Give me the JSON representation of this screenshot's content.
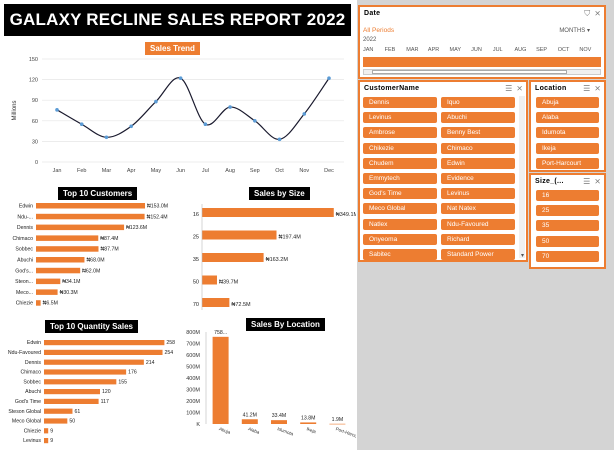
{
  "report": {
    "title": "GALAXY RECLINE SALES REPORT 2022"
  },
  "charts": {
    "sales_trend_title": "Sales Trend",
    "top_customers_title": "Top 10 Customers",
    "sales_by_size_title": "Sales by Size",
    "top_quantity_title": "Top 10 Quantity Sales",
    "sales_by_location_title": "Sales By Location"
  },
  "chart_data": [
    {
      "id": "sales_trend",
      "type": "line",
      "title": "Sales Trend",
      "ylabel": "Millions",
      "xlabel": "",
      "categories": [
        "Jan",
        "Feb",
        "Mar",
        "Apr",
        "May",
        "Jun",
        "Jul",
        "Aug",
        "Sep",
        "Oct",
        "Nov",
        "Dec"
      ],
      "values": [
        76,
        55,
        36,
        52,
        88,
        122,
        55,
        80,
        60,
        33,
        70,
        122
      ],
      "ylim": [
        0,
        150
      ],
      "yticks": [
        0,
        30,
        60,
        90,
        120,
        150
      ],
      "grid": true,
      "color": "#1f4e79",
      "marker_color": "#5b9bd5"
    },
    {
      "id": "top_customers",
      "type": "bar",
      "orientation": "horizontal",
      "title": "Top 10 Customers",
      "categories": [
        "Edwin",
        "Ndu-...",
        "Dennis",
        "Chimaco",
        "Sobbec",
        "Abuchi",
        "God's...",
        "Steon...",
        "Meco...",
        "Chiezie"
      ],
      "values": [
        153.0,
        152.4,
        123.6,
        87.4,
        87.7,
        68.0,
        62.0,
        34.1,
        30.3,
        6.5
      ],
      "labels": [
        "₦153.0M",
        "₦152.4M",
        "₦123.6M",
        "₦87.4M",
        "₦87.7M",
        "₦68.0M",
        "₦62.0M",
        "₦34.1M",
        "₦30.3M",
        "₦6.5M"
      ],
      "xlim": [
        0,
        160
      ],
      "color": "#ed7d31"
    },
    {
      "id": "sales_by_size",
      "type": "bar",
      "orientation": "horizontal",
      "title": "Sales by Size",
      "categories": [
        "16",
        "25",
        "35",
        "50",
        "70"
      ],
      "values": [
        349.1,
        197.4,
        163.2,
        39.7,
        72.5
      ],
      "labels": [
        "₦349.1M",
        "₦197.4M",
        "₦163.2M",
        "₦39.7M",
        "₦72.5M"
      ],
      "xlim": [
        0,
        355
      ],
      "color": "#ed7d31"
    },
    {
      "id": "top_quantity",
      "type": "bar",
      "orientation": "horizontal",
      "title": "Top 10 Quantity Sales",
      "categories": [
        "Edwin",
        "Ndu-Favoured",
        "Dennis",
        "Chimaco",
        "Sobbec",
        "Abuchi",
        "God's Time",
        "Steson Global",
        "Meco Global",
        "Chiezie",
        "Levinus"
      ],
      "values": [
        258,
        254,
        214,
        176,
        155,
        120,
        117,
        61,
        50,
        9,
        9
      ],
      "labels": [
        "258",
        "254",
        "214",
        "176",
        "155",
        "120",
        "117",
        "61",
        "50",
        "9",
        "9"
      ],
      "xlim": [
        0,
        270
      ],
      "color": "#ed7d31"
    },
    {
      "id": "sales_by_location",
      "type": "bar",
      "orientation": "vertical",
      "title": "Sales By Location",
      "categories": [
        "Abuja",
        "Alaba",
        "Idumota",
        "Ikeja",
        "Port-Harcourt"
      ],
      "values": [
        758,
        41.2,
        33.4,
        13.8,
        1.9
      ],
      "labels": [
        "758...",
        "41.2M",
        "33.4M",
        "13.8M",
        "1.9M"
      ],
      "ylim": [
        0,
        800
      ],
      "yticks": [
        "K",
        "100M",
        "200M",
        "300M",
        "400M",
        "500M",
        "600M",
        "700M",
        "800M"
      ],
      "color": "#ed7d31"
    }
  ],
  "slicers": {
    "date": {
      "header": "Date",
      "all_periods": "All Periods",
      "months_label": "MONTHS",
      "year": "2022",
      "months": [
        "JAN",
        "FEB",
        "MAR",
        "APR",
        "MAY",
        "JUN",
        "JUL",
        "AUG",
        "SEP",
        "OCT",
        "NOV"
      ]
    },
    "customer": {
      "header": "CustomerName",
      "items": [
        "Dennis",
        "Iquo",
        "Levinus",
        "Abuchi",
        "Ambrose",
        "Benny Best",
        "Chikezie",
        "Chimaco",
        "Chudem",
        "Edwin",
        "Emmytech",
        "Evidence",
        "God's Time",
        "Levinus",
        "Meco Global",
        "Nat Natex",
        "Natlex",
        "Ndu-Favoured",
        "Onyeoma",
        "Richard",
        "Sabitec",
        "Standard Power"
      ]
    },
    "location": {
      "header": "Location",
      "items": [
        "Abuja",
        "Alaba",
        "Idumota",
        "Ikeja",
        "Port-Harcourt"
      ]
    },
    "size": {
      "header": "Size_(...",
      "items": [
        "16",
        "25",
        "35",
        "50",
        "70"
      ]
    }
  },
  "colors": {
    "accent": "#ed7d31",
    "title_bg": "#000000",
    "line": "#1f4e79"
  }
}
